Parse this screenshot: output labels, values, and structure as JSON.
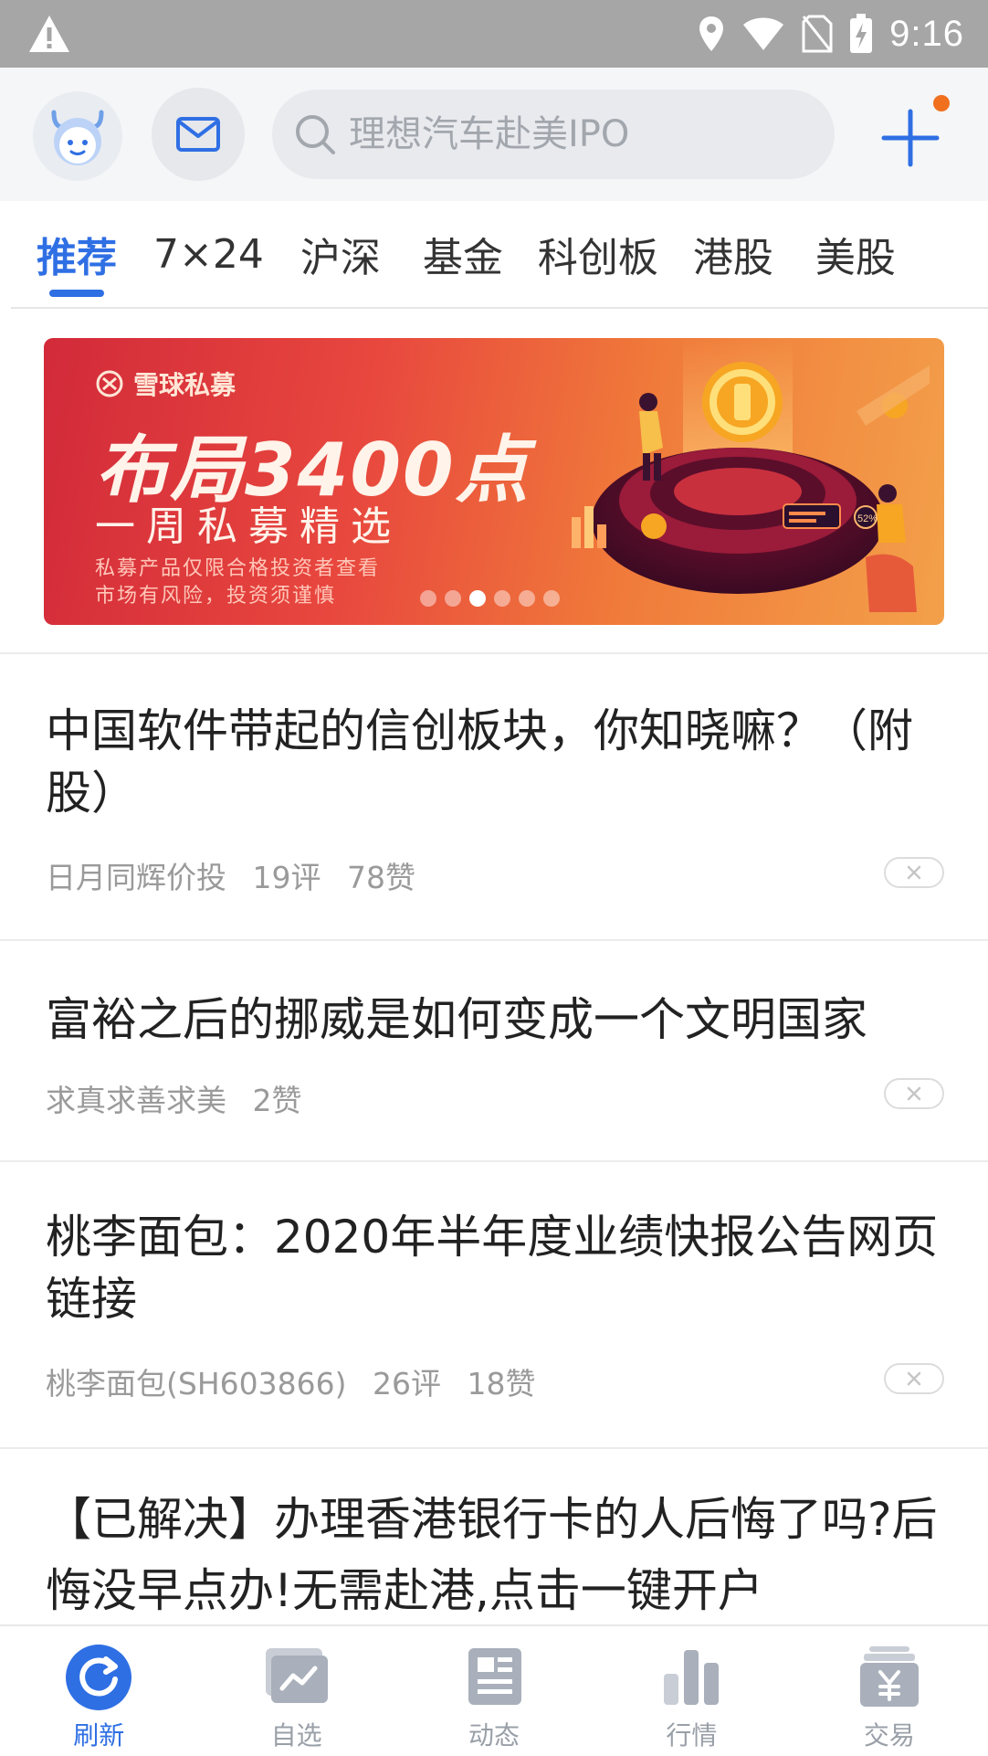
{
  "status_bar": {
    "time": "9:16"
  },
  "header": {
    "search_placeholder": "理想汽车赴美IPO"
  },
  "tabs": [
    {
      "label": "推荐",
      "active": true
    },
    {
      "label": "7×24"
    },
    {
      "label": "沪深"
    },
    {
      "label": "基金"
    },
    {
      "label": "科创板"
    },
    {
      "label": "港股"
    },
    {
      "label": "美股"
    }
  ],
  "banner": {
    "brand": "雪球私募",
    "headline": "布局3400点",
    "sub": "一周私募精选",
    "note1": "私募产品仅限合格投资者查看",
    "note2": "市场有风险，投资须谨慎",
    "badge": "52%",
    "slides": 6,
    "active_slide": 3
  },
  "feed": [
    {
      "title": "中国软件带起的信创板块，你知晓嘛？（附股）",
      "author": "日月同辉价投",
      "comments": "19评",
      "likes": "78赞"
    },
    {
      "title": "富裕之后的挪威是如何变成一个文明国家",
      "author": "求真求善求美",
      "comments": "",
      "likes": "2赞"
    },
    {
      "title": "桃李面包：2020年半年度业绩快报公告网页链接",
      "author": "桃李面包(SH603866)",
      "comments": "26评",
      "likes": "18赞"
    },
    {
      "title": "【已解决】办理香港银行卡的人后悔了吗?后悔没早点办!无需赴港,点击一键开户"
    }
  ],
  "bottom_nav": [
    {
      "label": "刷新",
      "icon": "refresh-icon",
      "active": true
    },
    {
      "label": "自选",
      "icon": "watchlist-icon"
    },
    {
      "label": "动态",
      "icon": "feed-icon"
    },
    {
      "label": "行情",
      "icon": "market-icon"
    },
    {
      "label": "交易",
      "icon": "trade-icon"
    }
  ],
  "colors": {
    "accent": "#2f6fe4",
    "notify_dot": "#f0701e",
    "status_bar": "#a6a6a6"
  }
}
